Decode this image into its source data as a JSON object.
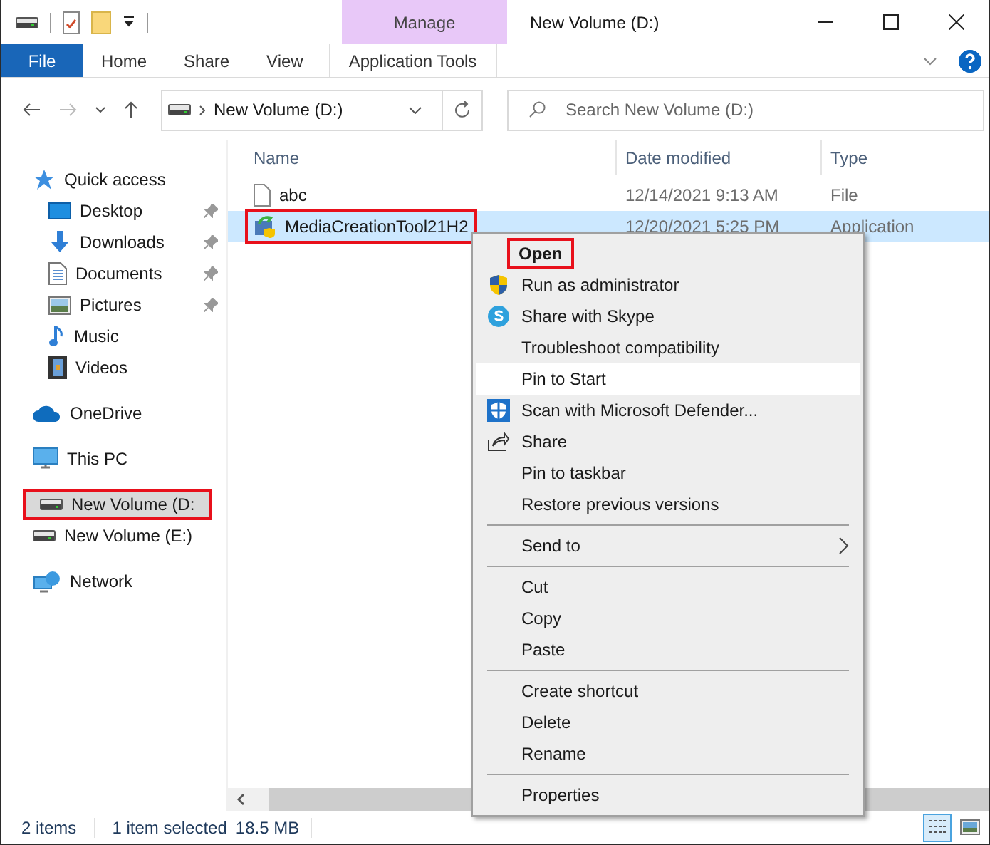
{
  "window": {
    "title": "New Volume (D:)"
  },
  "ribbon": {
    "context_group": "Manage",
    "tabs": [
      {
        "label": "File",
        "kind": "file",
        "selected": false
      },
      {
        "label": "Home",
        "kind": "tab",
        "selected": false
      },
      {
        "label": "Share",
        "kind": "tab",
        "selected": false
      },
      {
        "label": "View",
        "kind": "tab",
        "selected": false
      },
      {
        "label": "Application Tools",
        "kind": "context",
        "selected": false
      }
    ]
  },
  "address_bar": {
    "path": "New Volume (D:)"
  },
  "search": {
    "placeholder": "Search New Volume (D:)"
  },
  "sidebar": {
    "items": [
      {
        "label": "Quick access",
        "kind": "star",
        "selected": false,
        "annotated": false,
        "children": [
          {
            "label": "Desktop",
            "kind": "desktop",
            "pinned": true,
            "selected": false,
            "annotated": false
          },
          {
            "label": "Downloads",
            "kind": "download",
            "pinned": true,
            "selected": false,
            "annotated": false
          },
          {
            "label": "Documents",
            "kind": "document",
            "pinned": true,
            "selected": false,
            "annotated": false
          },
          {
            "label": "Pictures",
            "kind": "picture",
            "pinned": true,
            "selected": false,
            "annotated": false
          },
          {
            "label": "Music",
            "kind": "music",
            "pinned": false,
            "selected": false,
            "annotated": false
          },
          {
            "label": "Videos",
            "kind": "video",
            "pinned": false,
            "selected": false,
            "annotated": false
          }
        ]
      },
      {
        "label": "OneDrive",
        "kind": "cloud",
        "selected": false,
        "annotated": false
      },
      {
        "label": "This PC",
        "kind": "pc",
        "selected": false,
        "annotated": false
      },
      {
        "label": "New Volume (D:",
        "kind": "drive",
        "selected": true,
        "annotated": true
      },
      {
        "label": "New Volume (E:)",
        "kind": "drive",
        "selected": false,
        "annotated": false
      },
      {
        "label": "Network",
        "kind": "network",
        "selected": false,
        "annotated": false
      }
    ]
  },
  "file_list": {
    "columns": [
      "Name",
      "Date modified",
      "Type"
    ],
    "rows": [
      {
        "name": "abc",
        "date": "12/14/2021 9:13 AM",
        "type": "File",
        "kind": "file",
        "selected": false,
        "annotated": false
      },
      {
        "name": "MediaCreationTool21H2",
        "date": "12/20/2021 5:25 PM",
        "type": "Application",
        "kind": "app",
        "selected": true,
        "annotated": true
      }
    ]
  },
  "context_menu": {
    "items": [
      {
        "kind": "item",
        "label": "Open",
        "bold": true,
        "annotated": true,
        "hovered": false
      },
      {
        "kind": "shield",
        "label": "Run as administrator",
        "hovered": false
      },
      {
        "kind": "skype",
        "label": "Share with Skype",
        "hovered": false
      },
      {
        "kind": "item",
        "label": "Troubleshoot compatibility",
        "hovered": false
      },
      {
        "kind": "item",
        "label": "Pin to Start",
        "hovered": true
      },
      {
        "kind": "defender",
        "label": "Scan with Microsoft Defender...",
        "hovered": false
      },
      {
        "kind": "share",
        "label": "Share",
        "hovered": false
      },
      {
        "kind": "item",
        "label": "Pin to taskbar",
        "hovered": false
      },
      {
        "kind": "item",
        "label": "Restore previous versions",
        "hovered": false
      },
      {
        "kind": "separator"
      },
      {
        "kind": "item",
        "label": "Send to",
        "submenu": true,
        "hovered": false
      },
      {
        "kind": "separator"
      },
      {
        "kind": "item",
        "label": "Cut",
        "hovered": false
      },
      {
        "kind": "item",
        "label": "Copy",
        "hovered": false
      },
      {
        "kind": "item",
        "label": "Paste",
        "hovered": false
      },
      {
        "kind": "separator"
      },
      {
        "kind": "item",
        "label": "Create shortcut",
        "hovered": false
      },
      {
        "kind": "item",
        "label": "Delete",
        "hovered": false
      },
      {
        "kind": "item",
        "label": "Rename",
        "hovered": false
      },
      {
        "kind": "separator"
      },
      {
        "kind": "item",
        "label": "Properties",
        "hovered": false
      }
    ]
  },
  "status_bar": {
    "item_count": "2 items",
    "selection": "1 item selected",
    "size": "18.5 MB",
    "views": [
      {
        "kind": "details",
        "selected": true
      },
      {
        "kind": "thumbnails",
        "selected": false
      }
    ]
  }
}
